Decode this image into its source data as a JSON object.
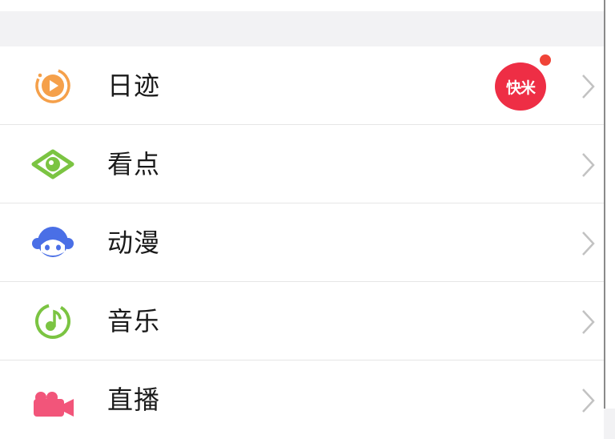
{
  "menu": {
    "items": [
      {
        "label": "日迹",
        "icon": "riji-clock-play-icon",
        "color": "#f5a04a",
        "badge": "快米",
        "has_dot": true
      },
      {
        "label": "看点",
        "icon": "eye-icon",
        "color": "#7bc442"
      },
      {
        "label": "动漫",
        "icon": "anime-character-icon",
        "color": "#4a6fe6"
      },
      {
        "label": "音乐",
        "icon": "music-note-icon",
        "color": "#7bc442"
      },
      {
        "label": "直播",
        "icon": "live-camera-icon",
        "color": "#f2557a"
      }
    ]
  },
  "colors": {
    "badge_bg": "#ee2e45",
    "dot": "#f04438",
    "chevron": "#c2c2c2"
  }
}
